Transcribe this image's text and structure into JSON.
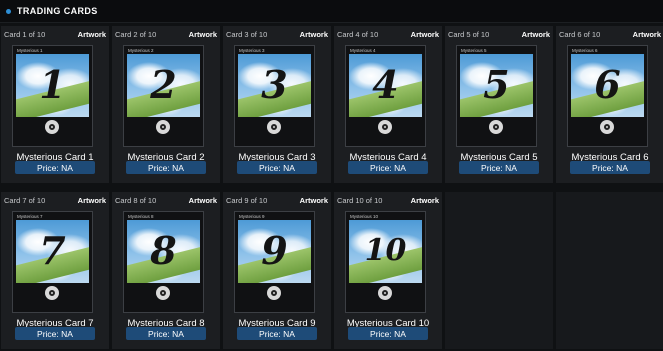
{
  "header": {
    "title": "TRADING CARDS",
    "accent_color": "#2e8fd6"
  },
  "artwork_label": "Artwork",
  "cards": [
    {
      "index_label": "Card 1 of 10",
      "small_name": "Mysterious 1",
      "number": "1",
      "name": "Mysterious Card 1",
      "price": "Price: NA"
    },
    {
      "index_label": "Card 2 of 10",
      "small_name": "Mysterious 2",
      "number": "2",
      "name": "Mysterious Card 2",
      "price": "Price: NA"
    },
    {
      "index_label": "Card 3 of 10",
      "small_name": "Mysterious 3",
      "number": "3",
      "name": "Mysterious Card 3",
      "price": "Price: NA"
    },
    {
      "index_label": "Card 4 of 10",
      "small_name": "Mysterious 4",
      "number": "4",
      "name": "Mysterious Card 4",
      "price": "Price: NA"
    },
    {
      "index_label": "Card 5 of 10",
      "small_name": "Mysterious 5",
      "number": "5",
      "name": "Mysterious Card 5",
      "price": "Price: NA"
    },
    {
      "index_label": "Card 6 of 10",
      "small_name": "Mysterious 6",
      "number": "6",
      "name": "Mysterious Card 6",
      "price": "Price: NA"
    },
    {
      "index_label": "Card 7 of 10",
      "small_name": "Mysterious 7",
      "number": "7",
      "name": "Mysterious Card 7",
      "price": "Price: NA"
    },
    {
      "index_label": "Card 8 of 10",
      "small_name": "Mysterious 8",
      "number": "8",
      "name": "Mysterious Card 8",
      "price": "Price: NA"
    },
    {
      "index_label": "Card 9 of 10",
      "small_name": "Mysterious 9",
      "number": "9",
      "name": "Mysterious Card 9",
      "price": "Price: NA"
    },
    {
      "index_label": "Card 10 of 10",
      "small_name": "Mysterious 10",
      "number": "10",
      "name": "Mysterious Card 10",
      "price": "Price: NA"
    }
  ]
}
